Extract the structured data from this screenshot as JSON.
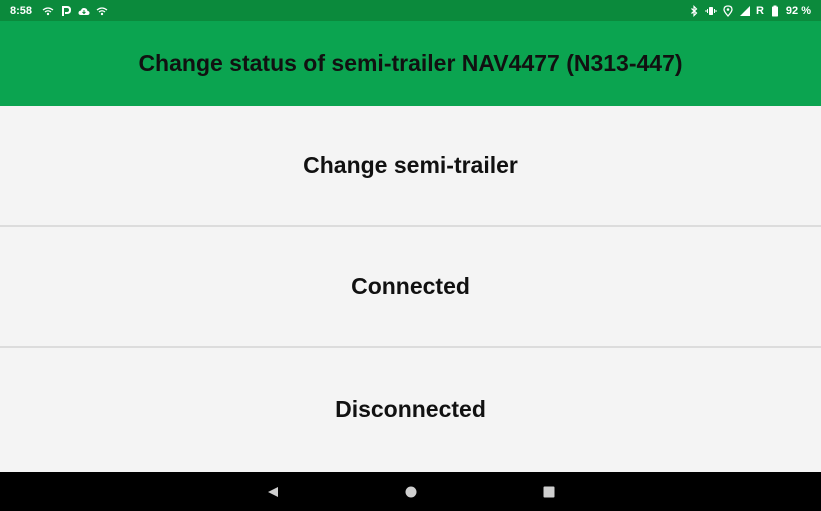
{
  "status_bar": {
    "time": "8:58",
    "battery_percent": "92 %",
    "signal_roaming": "R",
    "left_icons": [
      "wifi-calling-icon",
      "parking-icon",
      "cloud-icon",
      "wifi-calling-icon"
    ],
    "right_icons": [
      "bluetooth-icon",
      "vibrate-icon",
      "location-icon",
      "signal-icon",
      "battery-icon"
    ]
  },
  "header": {
    "title": "Change status of semi-trailer NAV4477 (N313-447)"
  },
  "options": [
    {
      "label": "Change semi-trailer"
    },
    {
      "label": "Connected"
    },
    {
      "label": "Disconnected"
    }
  ],
  "nav_bar": {
    "buttons": [
      "back-icon",
      "home-icon",
      "recents-icon"
    ]
  },
  "colors": {
    "status_bar": "#0b8a3c",
    "header": "#0ba450",
    "background": "#f4f4f4",
    "divider": "#dcdcdc",
    "nav_bar": "#000000"
  }
}
